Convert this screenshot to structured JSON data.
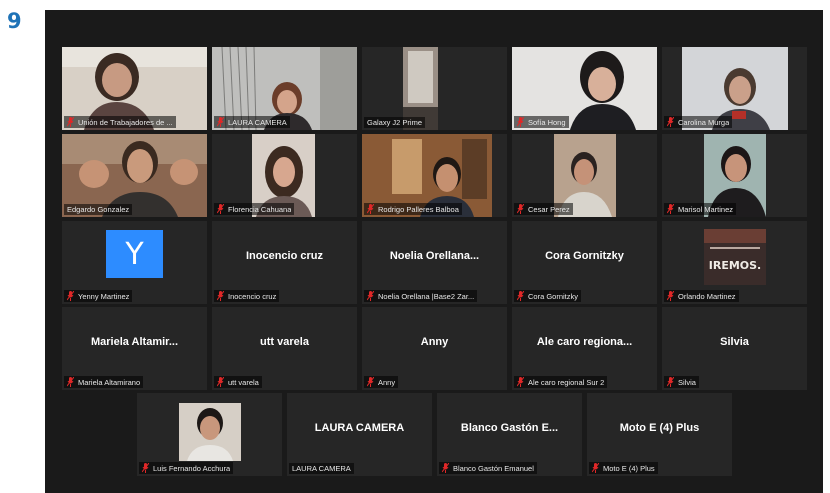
{
  "page_number": "9",
  "participants": [
    {
      "id": "union",
      "label": "Unión de Trabajadores de ...",
      "muted": true
    },
    {
      "id": "laura1",
      "label": "LAURA CAMERA",
      "muted": true
    },
    {
      "id": "galaxy",
      "label": "Galaxy J2 Prime",
      "muted": false
    },
    {
      "id": "sofia",
      "label": "Sofía Hong",
      "muted": true
    },
    {
      "id": "carolina",
      "label": "Carolina Murga",
      "muted": true
    },
    {
      "id": "edgardo",
      "label": "Edgardo Gonzalez",
      "muted": false,
      "active": true
    },
    {
      "id": "florencia",
      "label": "Florencia Cahuana",
      "muted": true
    },
    {
      "id": "rodrigo",
      "label": "Rodrigo Palleres Balboa",
      "muted": true
    },
    {
      "id": "cesar",
      "label": "Cesar Perez",
      "muted": true
    },
    {
      "id": "marisol",
      "label": "Marisol Martinez",
      "muted": true
    },
    {
      "id": "yenny",
      "label": "Yenny Martinez",
      "muted": true,
      "avatar_letter": "Y"
    },
    {
      "id": "inocencio",
      "label": "Inocencio cruz",
      "muted": true,
      "display_name": "Inocencio cruz"
    },
    {
      "id": "noelia",
      "label": "Noelia Orellana |Base2 Zar...",
      "muted": true,
      "display_name": "Noelia Orellana..."
    },
    {
      "id": "cora",
      "label": "Cora Gornitzky",
      "muted": true,
      "display_name": "Cora Gornitzky"
    },
    {
      "id": "orlando",
      "label": "Orlando Martinez",
      "muted": true,
      "poster_text": "IREMOS."
    },
    {
      "id": "mariela",
      "label": "Mariela Altamirano",
      "muted": true,
      "display_name": "Mariela Altamir..."
    },
    {
      "id": "utt",
      "label": "utt varela",
      "muted": true,
      "display_name": "utt varela"
    },
    {
      "id": "anny",
      "label": "Anny",
      "muted": true,
      "display_name": "Anny"
    },
    {
      "id": "alecaro",
      "label": "Ale caro regional Sur 2",
      "muted": true,
      "display_name": "Ale caro regiona..."
    },
    {
      "id": "silvia",
      "label": "Silvia",
      "muted": true,
      "display_name": "Silvia"
    },
    {
      "id": "luis",
      "label": "Luis Fernando Acchura",
      "muted": true
    },
    {
      "id": "laura2",
      "label": "LAURA CAMERA",
      "muted": false,
      "display_name": "LAURA CAMERA"
    },
    {
      "id": "blanco",
      "label": "Blanco Gastón Emanuel",
      "muted": true,
      "display_name": "Blanco Gastón E..."
    },
    {
      "id": "moto",
      "label": "Moto E (4) Plus",
      "muted": true,
      "display_name": "Moto E (4) Plus"
    }
  ],
  "colors": {
    "background": "#1a1a1a",
    "tile": "#262626",
    "active_border": "#b5e34b",
    "mic_muted": "#e02828",
    "avatar": "#2d8cff",
    "page_number": "#1f73b7"
  }
}
